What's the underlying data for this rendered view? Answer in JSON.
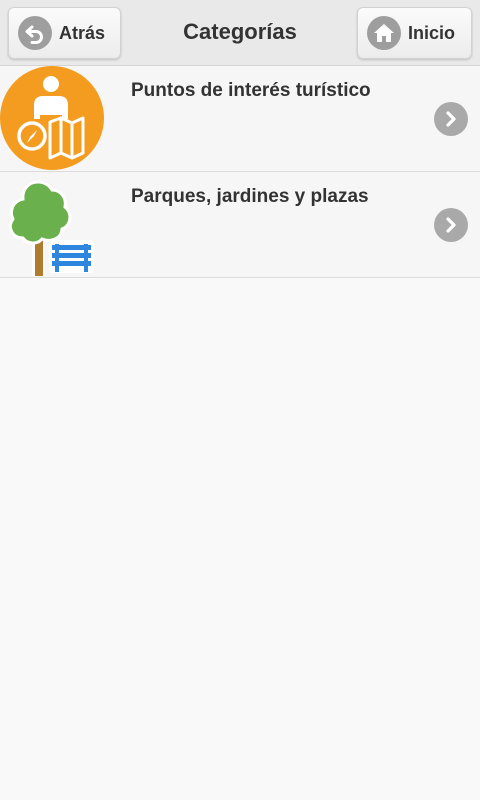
{
  "header": {
    "title": "Categorías",
    "back_label": "Atrás",
    "home_label": "Inicio",
    "back_icon": "undo-arrow-icon",
    "home_icon": "home-icon"
  },
  "categories": [
    {
      "label": "Puntos de interés turístico",
      "icon": "tourist-map-compass-icon",
      "accent": "#f39c1f"
    },
    {
      "label": "Parques, jardines y plazas",
      "icon": "tree-bench-icon",
      "accent": "#6ab04c"
    }
  ],
  "colors": {
    "header_bg": "#e9e9e9",
    "text": "#333333",
    "chevron_bg": "#a9a9a9",
    "list_bg": "#f6f6f6"
  }
}
